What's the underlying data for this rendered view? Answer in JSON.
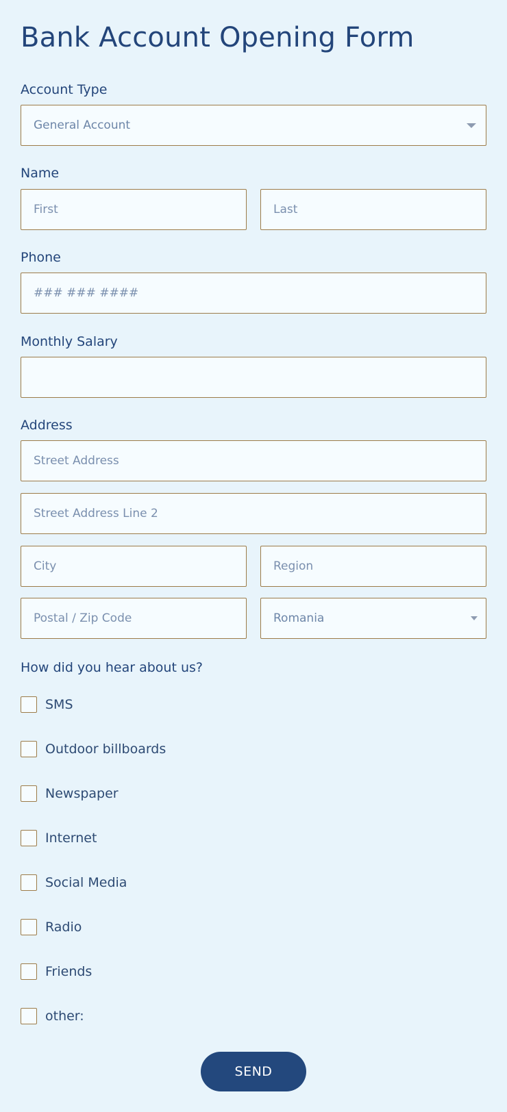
{
  "form": {
    "title": "Bank Account Opening Form",
    "account_type": {
      "label": "Account Type",
      "selected": "General Account"
    },
    "name": {
      "label": "Name",
      "first_placeholder": "First",
      "last_placeholder": "Last"
    },
    "phone": {
      "label": "Phone",
      "placeholder": "### ### ####"
    },
    "monthly_salary": {
      "label": "Monthly Salary",
      "value": ""
    },
    "address": {
      "label": "Address",
      "street_placeholder": "Street Address",
      "street2_placeholder": "Street Address Line 2",
      "city_placeholder": "City",
      "region_placeholder": "Region",
      "postal_placeholder": "Postal / Zip Code",
      "country_selected": "Romania"
    },
    "hear_about": {
      "label": "How did you hear about us?",
      "options": [
        "SMS",
        "Outdoor billboards",
        "Newspaper",
        "Internet",
        "Social Media",
        "Radio",
        "Friends",
        "other:"
      ]
    },
    "send_label": "SEND"
  },
  "colors": {
    "background": "#e8f4fb",
    "primary": "#23487d",
    "field_border": "#9c7b48",
    "field_background": "#f6fcff"
  },
  "icons": {
    "dropdown": "caret-down-icon"
  }
}
